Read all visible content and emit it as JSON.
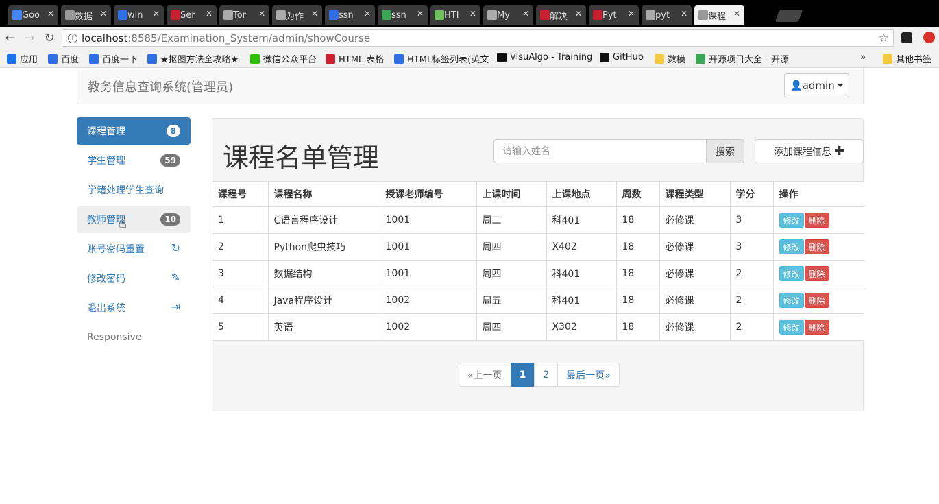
{
  "browser": {
    "tabs": [
      {
        "label": "Goo",
        "color": "#4285f4"
      },
      {
        "label": "数据",
        "color": "#999999"
      },
      {
        "label": "win",
        "color": "#2f6fe4"
      },
      {
        "label": "Ser",
        "color": "#c8202f"
      },
      {
        "label": "Tor",
        "color": "#aaaaaa"
      },
      {
        "label": "为作",
        "color": "#aaaaaa"
      },
      {
        "label": "ssn",
        "color": "#2f6fe4"
      },
      {
        "label": "ssn",
        "color": "#3aa757"
      },
      {
        "label": "HTI",
        "color": "#6fbf5a"
      },
      {
        "label": "My",
        "color": "#aaaaaa"
      },
      {
        "label": "解决",
        "color": "#c8202f"
      },
      {
        "label": "Pyt",
        "color": "#c8202f"
      },
      {
        "label": "pyt",
        "color": "#aaaaaa"
      },
      {
        "label": "课程",
        "color": "#999999",
        "active": true
      }
    ],
    "close_glyph": "✕",
    "address": {
      "host": "localhost",
      "path": ":8585/Examination_System/admin/showCourse"
    },
    "bookmarks": [
      {
        "label": "应用",
        "color": "#1a73e8"
      },
      {
        "label": "百度",
        "color": "#2f6fe4"
      },
      {
        "label": "百度一下",
        "color": "#2f6fe4"
      },
      {
        "label": "★抠图方法全攻略★",
        "color": "#2f6fe4"
      },
      {
        "label": "微信公众平台",
        "color": "#2dc100"
      },
      {
        "label": "HTML 表格",
        "color": "#c8202f"
      },
      {
        "label": "HTML标签列表(英文",
        "color": "#2f6fe4"
      },
      {
        "label": "VisuAlgo - Training",
        "color": "#111111"
      },
      {
        "label": "GitHub",
        "color": "#111111"
      },
      {
        "label": "数模",
        "color": "#f5c842"
      },
      {
        "label": "开源项目大全 - 开源",
        "color": "#3aa757"
      }
    ],
    "bookmarks_more": "»",
    "other_bookmarks": "其他书签"
  },
  "navbar": {
    "brand": "教务信息查询系统(管理员)",
    "user": "admin"
  },
  "sidebar": {
    "items": [
      {
        "label": "课程管理",
        "badge": "8"
      },
      {
        "label": "学生管理",
        "badge": "59"
      },
      {
        "label": "学籍处理学生查询"
      },
      {
        "label": "教师管理",
        "badge": "10"
      },
      {
        "label": "账号密码重置",
        "icon": "↻"
      },
      {
        "label": "修改密码",
        "icon": "✎"
      },
      {
        "label": "退出系统",
        "icon": "⇥"
      },
      {
        "label": "Responsive"
      }
    ]
  },
  "main": {
    "title": "课程名单管理",
    "search": {
      "placeholder": "请输入姓名",
      "button": "搜索"
    },
    "add_button": "添加课程信息",
    "table": {
      "headers": [
        "课程号",
        "课程名称",
        "授课老师编号",
        "上课时间",
        "上课地点",
        "周数",
        "课程类型",
        "学分",
        "操作"
      ],
      "rows": [
        [
          "1",
          "C语言程序设计",
          "1001",
          "周二",
          "科401",
          "18",
          "必修课",
          "3"
        ],
        [
          "2",
          "Python爬虫技巧",
          "1001",
          "周四",
          "X402",
          "18",
          "必修课",
          "3"
        ],
        [
          "3",
          "数据结构",
          "1001",
          "周四",
          "科401",
          "18",
          "必修课",
          "2"
        ],
        [
          "4",
          "Java程序设计",
          "1002",
          "周五",
          "科401",
          "18",
          "必修课",
          "2"
        ],
        [
          "5",
          "英语",
          "1002",
          "周四",
          "X302",
          "18",
          "必修课",
          "2"
        ]
      ],
      "edit_label": "修改",
      "delete_label": "删除"
    },
    "pagination": {
      "prev": "«上一页",
      "pages": [
        "1",
        "2"
      ],
      "current": "1",
      "last": "最后一页»"
    }
  },
  "colors": {
    "primary": "#337ab7",
    "info": "#5bc0de",
    "danger": "#d9534f",
    "badge": "#777777"
  }
}
